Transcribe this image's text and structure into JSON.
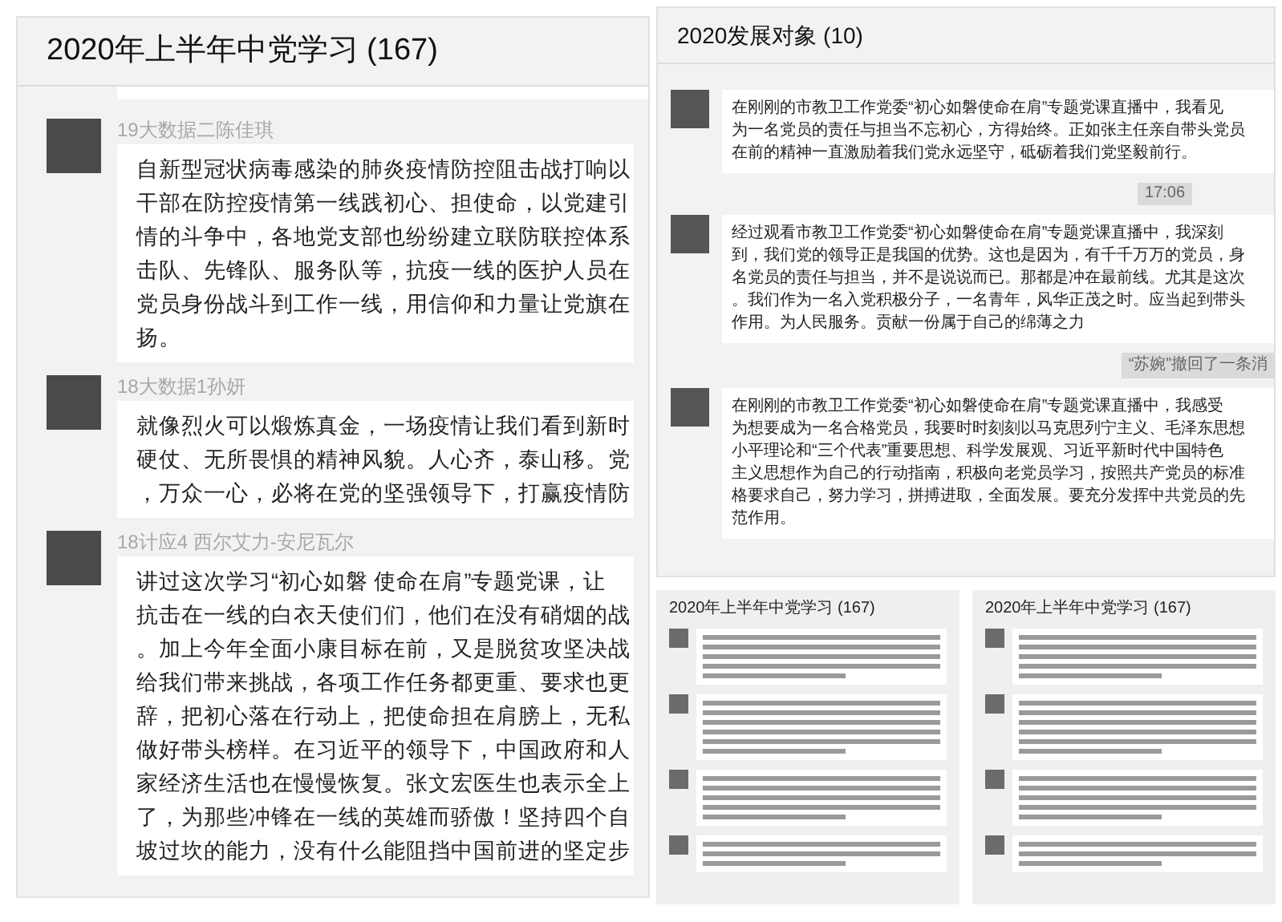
{
  "left_window": {
    "title": "2020年上半年中党学习 (167)",
    "messages": [
      {
        "sender": "19大数据二陈佳琪",
        "lines": [
          "自新型冠状病毒感染的肺炎疫情防控阻击战打响以",
          "干部在防控疫情第一线践初心、担使命，以党建引",
          "情的斗争中，各地党支部也纷纷建立联防联控体系",
          "击队、先锋队、服务队等，抗疫一线的医护人员在",
          "党员身份战斗到工作一线，用信仰和力量让党旗在",
          "扬。"
        ]
      },
      {
        "sender": "18大数据1孙妍",
        "lines": [
          "就像烈火可以煅炼真金，一场疫情让我们看到新时",
          "硬仗、无所畏惧的精神风貌。人心齐，泰山移。党",
          "，万众一心，必将在党的坚强领导下，打赢疫情防"
        ]
      },
      {
        "sender": "18计应4 西尔艾力-安尼瓦尔",
        "lines": [
          "讲过这次学习“初心如磐 使命在肩”专题党课，让",
          "抗击在一线的白衣天使们们，他们在没有硝烟的战",
          "。加上今年全面小康目标在前，又是脱贫攻坚决战",
          "给我们带来挑战，各项工作任务都更重、要求也更",
          "辞，把初心落在行动上，把使命担在肩膀上，无私",
          "做好带头榜样。在习近平的领导下，中国政府和人",
          "家经济生活也在慢慢恢复。张文宏医生也表示全上",
          "了，为那些冲锋在一线的英雄而骄傲！坚持四个自",
          "坡过坎的能力，没有什么能阻挡中国前进的坚定步"
        ]
      }
    ]
  },
  "right_window": {
    "title": "2020发展对象 (10)",
    "items": [
      {
        "kind": "message",
        "lines": [
          "在刚刚的市教卫工作党委“初心如磐使命在肩”专题党课直播中，我看见",
          "为一名党员的责任与担当不忘初心，方得始终。正如张主任亲自带头党员",
          "在前的精神一直激励着我们党永远坚守，砥砺着我们党坚毅前行。"
        ]
      },
      {
        "kind": "time",
        "text": "17:06"
      },
      {
        "kind": "message",
        "lines": [
          "经过观看市教卫工作党委“初心如磐使命在肩”专题党课直播中，我深刻",
          "到，我们党的领导正是我国的优势。这也是因为，有千千万万的党员，身",
          "名党员的责任与担当，并不是说说而已。那都是冲在最前线。尤其是这次",
          "。我们作为一名入党积极分子，一名青年，风华正茂之时。应当起到带头",
          "作用。为人民服务。贡献一份属于自己的绵薄之力"
        ]
      },
      {
        "kind": "notice",
        "text": "“苏婉”撤回了一条消"
      },
      {
        "kind": "message",
        "lines": [
          "在刚刚的市教卫工作党委“初心如磐使命在肩”专题党课直播中，我感受",
          "为想要成为一名合格党员，我要时时刻刻以马克思列宁主义、毛泽东思想",
          "小平理论和“三个代表”重要思想、科学发展观、习近平新时代中国特色",
          "主义思想作为自己的行动指南，积极向老党员学习，按照共产党员的标准",
          "格要求自己，努力学习，拼搏进取，全面发展。要充分发挥中共党员的先",
          "范作用。"
        ]
      }
    ]
  },
  "thumbnails": [
    {
      "title": "2020年上半年中党学习 (167)"
    },
    {
      "title": "2020年上半年中党学习 (167)"
    }
  ]
}
